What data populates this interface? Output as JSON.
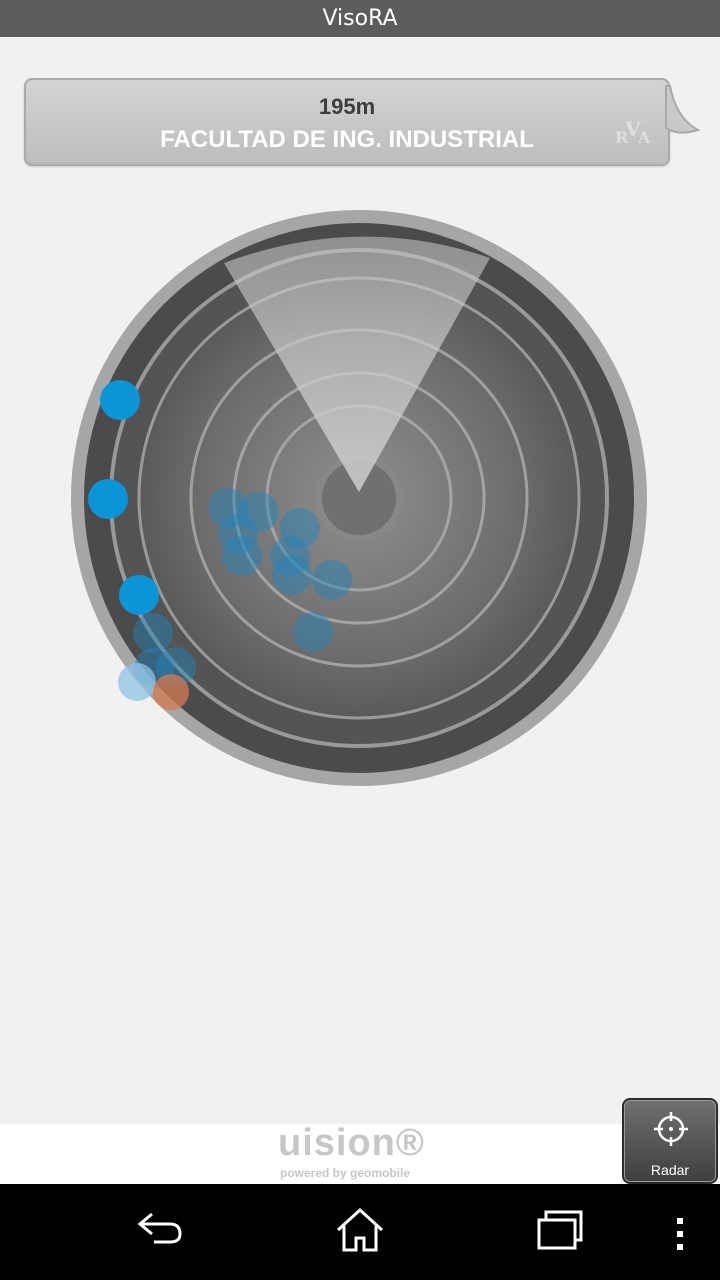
{
  "app": {
    "title": "VisoRA"
  },
  "poi": {
    "distance": "195m",
    "name": "FACULTAD DE ING. INDUSTRIAL"
  },
  "brand": {
    "watermark": "RVA"
  },
  "radar": {
    "accent": "#0a95d8",
    "points": [
      {
        "tone": "solid"
      },
      {
        "tone": "solid"
      },
      {
        "tone": "solid"
      },
      {
        "tone": "faded"
      },
      {
        "tone": "faded"
      },
      {
        "tone": "faded"
      },
      {
        "tone": "faded"
      },
      {
        "tone": "faded"
      },
      {
        "tone": "faded"
      },
      {
        "tone": "faded"
      },
      {
        "tone": "faded"
      },
      {
        "tone": "faded"
      },
      {
        "tone": "faded"
      },
      {
        "tone": "faded"
      },
      {
        "tone": "faded"
      },
      {
        "tone": "light"
      },
      {
        "tone": "orange"
      }
    ]
  },
  "footer": {
    "logo_text": "uision®",
    "powered_text": "powered by geomobile"
  },
  "radar_button": {
    "label": "Radar",
    "icon": "crosshair-icon"
  },
  "navigation": {
    "back_icon": "back-icon",
    "home_icon": "home-icon",
    "recents_icon": "recents-icon",
    "menu_icon": "overflow-menu-icon"
  }
}
